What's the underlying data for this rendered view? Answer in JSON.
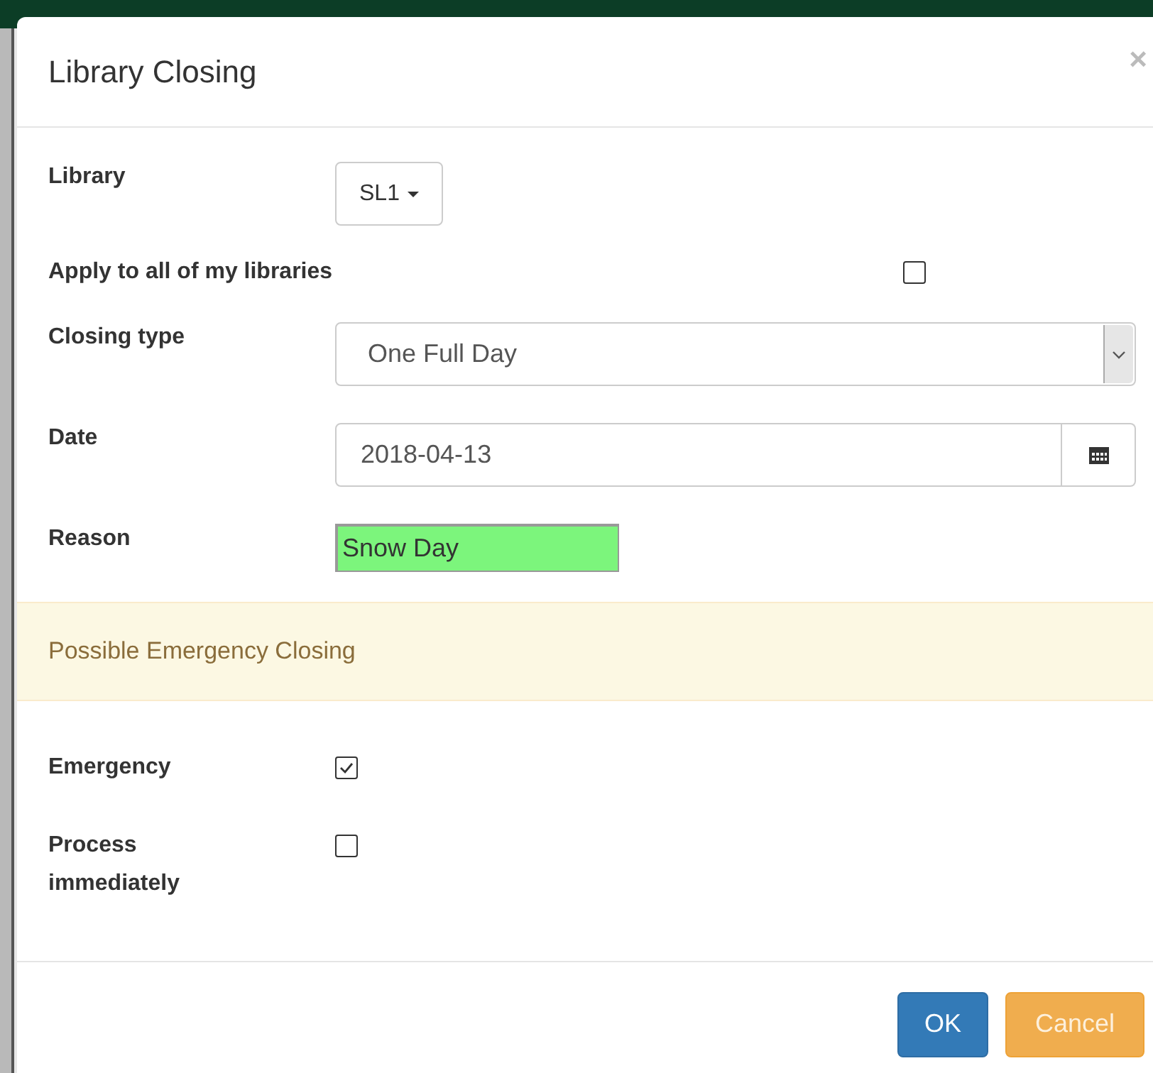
{
  "dialog": {
    "title": "Library Closing",
    "close_glyph": "×"
  },
  "library": {
    "label": "Library",
    "value": "SL1"
  },
  "apply_all": {
    "label": "Apply to all of my libraries",
    "checked": false
  },
  "closing_type": {
    "label": "Closing type",
    "value": "One Full Day"
  },
  "date": {
    "label": "Date",
    "value": "2018-04-13"
  },
  "reason": {
    "label": "Reason",
    "value": "Snow Day"
  },
  "alert": {
    "text": "Possible Emergency Closing"
  },
  "options": [
    {
      "label": "Emergency",
      "checked": true
    },
    {
      "label": "Process immediately",
      "checked": false
    }
  ],
  "buttons": [
    {
      "label": "OK",
      "kind": "primary"
    },
    {
      "label": "Cancel",
      "kind": "warning"
    }
  ]
}
